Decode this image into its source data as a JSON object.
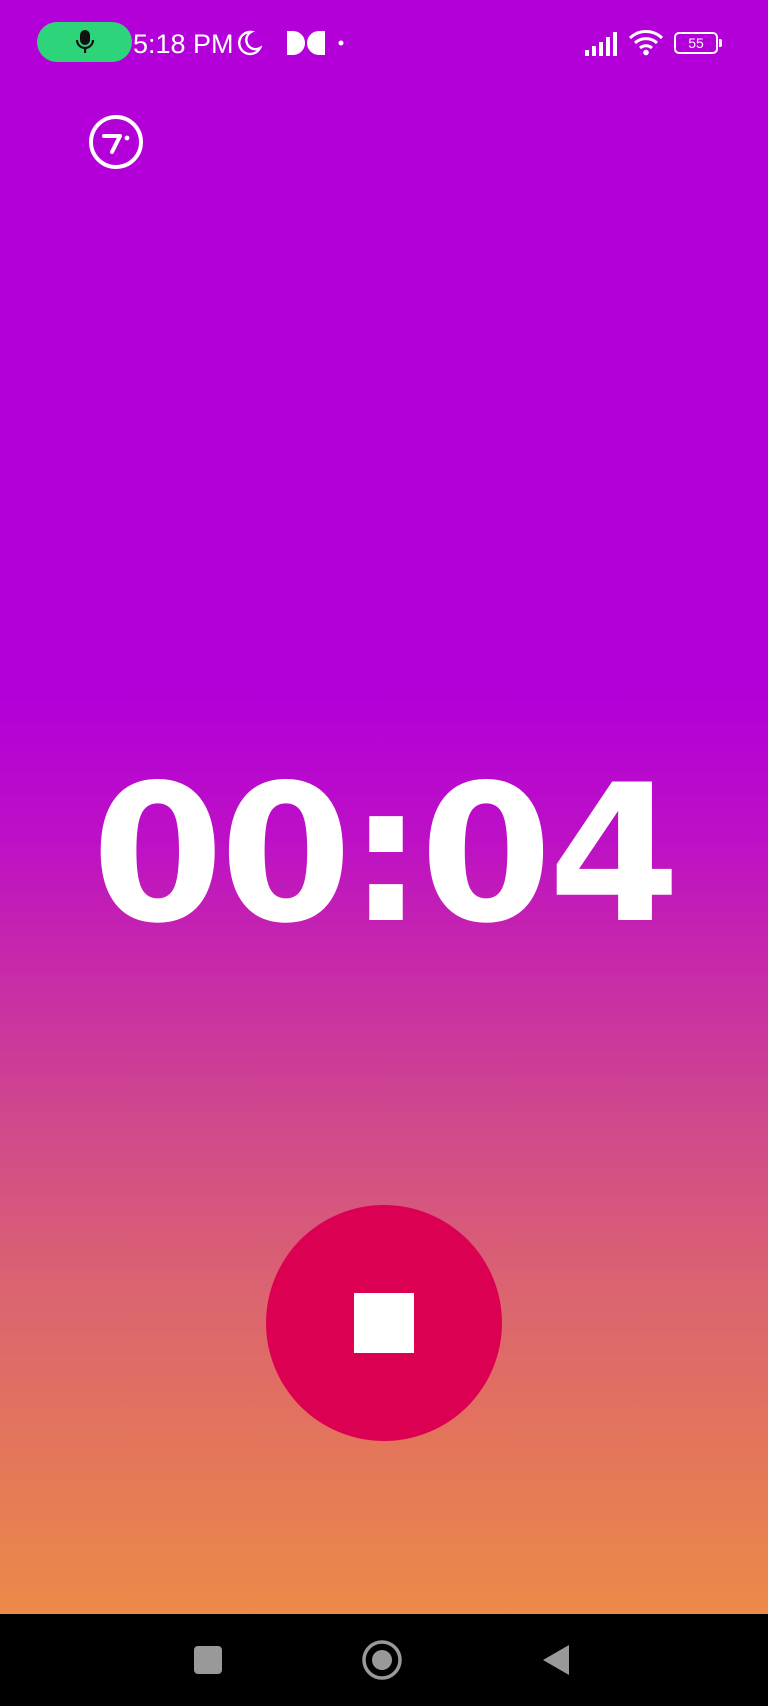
{
  "status_bar": {
    "time": "5:18 PM",
    "battery_level": "55",
    "icons": [
      "mic-icon",
      "moon-icon",
      "dolby-icon",
      "dot-icon",
      "signal-icon",
      "wifi-icon",
      "battery-icon"
    ]
  },
  "toolbar": {
    "speed_icon": "speedometer-icon"
  },
  "recorder": {
    "elapsed": "00:04",
    "stop_icon": "stop-icon"
  },
  "colors": {
    "gradient_top": "#b300d8",
    "gradient_bottom": "#ec8a48",
    "stop_button": "#dc0052",
    "mic_pill": "#2ed47a"
  },
  "navigation": {
    "recents_icon": "square-icon",
    "home_icon": "home-circle-icon",
    "back_icon": "back-triangle-icon"
  }
}
